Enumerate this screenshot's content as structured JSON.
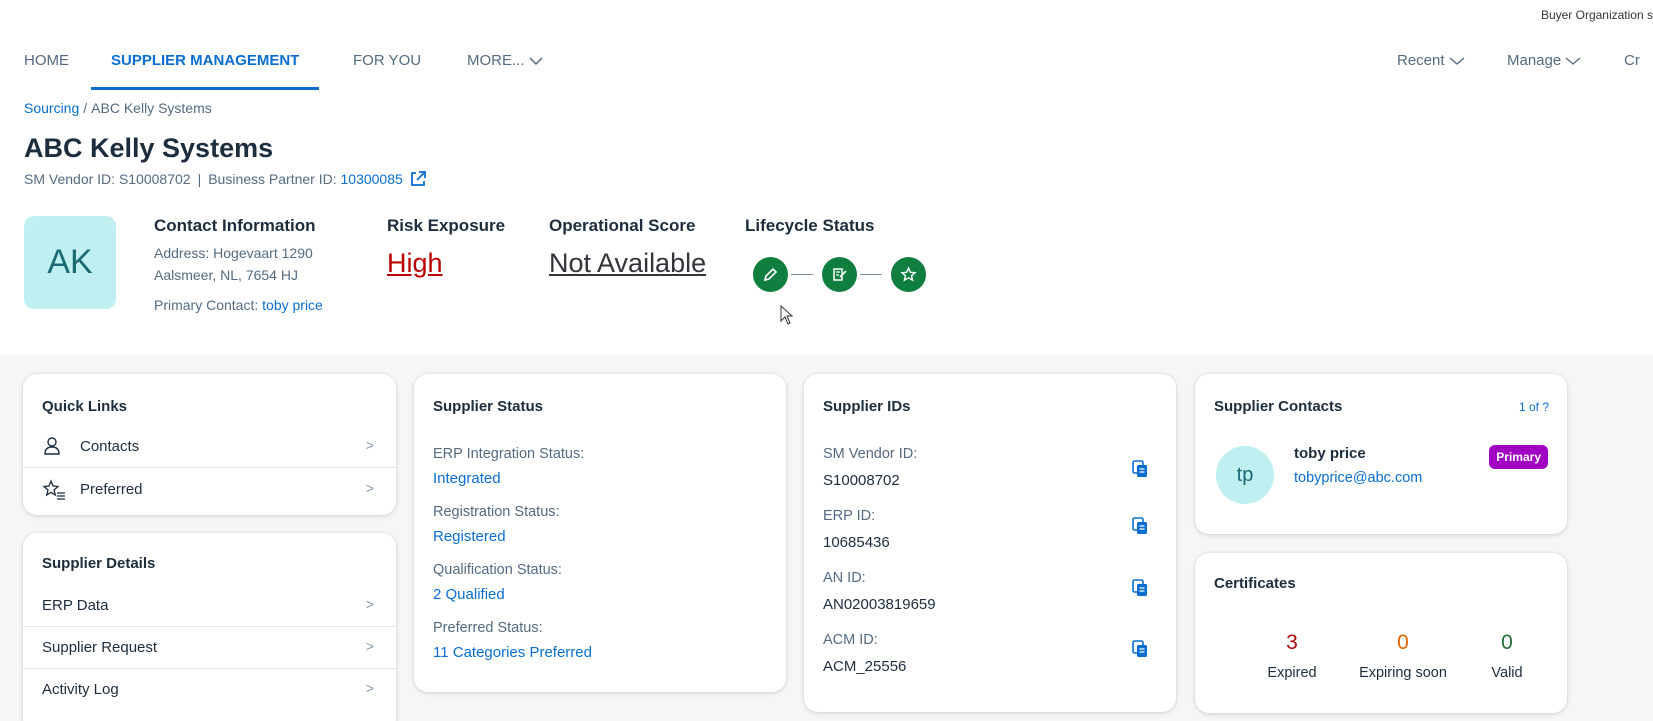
{
  "org_label": "Buyer Organization s",
  "nav": {
    "home": "HOME",
    "supplier_management": "SUPPLIER MANAGEMENT",
    "for_you": "FOR YOU",
    "more": "MORE...",
    "recent": "Recent",
    "manage": "Manage",
    "create": "Cr"
  },
  "breadcrumb": {
    "root": "Sourcing",
    "sep": "/",
    "current": "ABC Kelly Systems"
  },
  "supplier": {
    "name": "ABC Kelly Systems",
    "sm_vendor_label": "SM Vendor ID:",
    "sm_vendor_id": "S10008702",
    "bp_label": "Business Partner ID:",
    "bp_id": "10300085",
    "avatar_initials": "AK"
  },
  "header": {
    "contact_title": "Contact Information",
    "address_label": "Address:",
    "address_line1": "Hogevaart 1290",
    "address_line2": "Aalsmeer, NL, 7654 HJ",
    "primary_contact_label": "Primary Contact:",
    "primary_contact_name": "toby price",
    "risk_title": "Risk Exposure",
    "risk_value": "High",
    "opscore_title": "Operational Score",
    "opscore_value": "Not Available",
    "lifecycle_title": "Lifecycle Status"
  },
  "quick_links": {
    "title": "Quick Links",
    "items": [
      {
        "label": "Contacts"
      },
      {
        "label": "Preferred"
      }
    ]
  },
  "supplier_details": {
    "title": "Supplier Details",
    "items": [
      {
        "label": "ERP Data"
      },
      {
        "label": "Supplier Request"
      },
      {
        "label": "Activity Log"
      }
    ]
  },
  "supplier_status": {
    "title": "Supplier Status",
    "fields": [
      {
        "label": "ERP Integration Status:",
        "value": "Integrated"
      },
      {
        "label": "Registration Status:",
        "value": "Registered"
      },
      {
        "label": "Qualification Status:",
        "value": "2 Qualified"
      },
      {
        "label": "Preferred Status:",
        "value": "11 Categories Preferred"
      }
    ]
  },
  "supplier_ids": {
    "title": "Supplier IDs",
    "fields": [
      {
        "label": "SM Vendor ID:",
        "value": "S10008702"
      },
      {
        "label": "ERP ID:",
        "value": "10685436"
      },
      {
        "label": "AN ID:",
        "value": "AN02003819659"
      },
      {
        "label": "ACM ID:",
        "value": "ACM_25556"
      }
    ]
  },
  "supplier_contacts": {
    "title": "Supplier Contacts",
    "pager": "1 of ?",
    "initials": "tp",
    "name": "toby price",
    "email": "tobyprice@abc.com",
    "badge": "Primary"
  },
  "certificates": {
    "title": "Certificates",
    "expired_count": "3",
    "expired_label": "Expired",
    "expiring_count": "0",
    "expiring_label": "Expiring soon",
    "valid_count": "0",
    "valid_label": "Valid"
  },
  "colors": {
    "accent": "#0a6ed1",
    "risk_high": "#bb0000",
    "lifecycle_green": "#107e3e",
    "primary_badge": "#a100c2",
    "expired": "#aa0808",
    "expiring": "#e76500",
    "valid": "#256f3a"
  }
}
